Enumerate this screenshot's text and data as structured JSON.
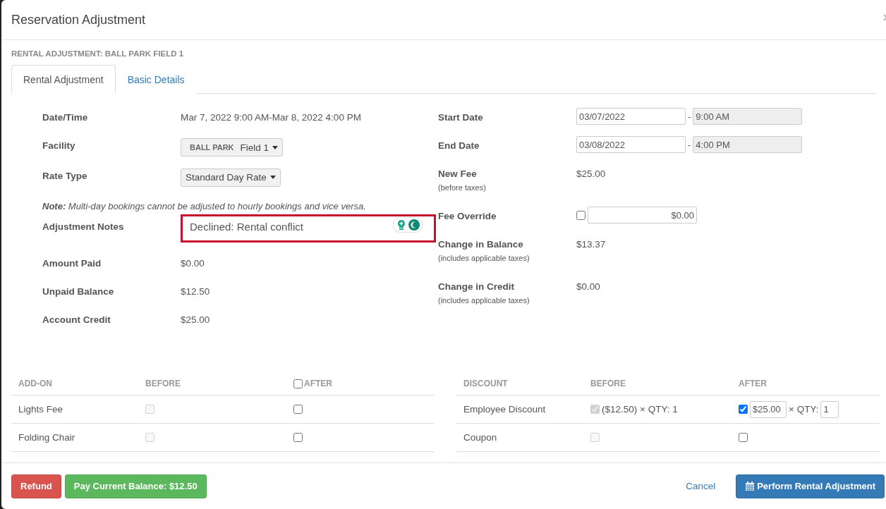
{
  "window": {
    "title": "Reservation Adjustment"
  },
  "section_title": "RENTAL ADJUSTMENT: BALL PARK FIELD 1",
  "tabs": [
    {
      "label": "Rental Adjustment",
      "selected": true
    },
    {
      "label": "Basic Details",
      "selected": false
    }
  ],
  "left_fields": [
    {
      "kind": "text",
      "label": "Date/Time",
      "value": "Mar 7, 2022 9:00 AM-Mar 8, 2022 4:00 PM"
    },
    {
      "kind": "select",
      "label": "Facility",
      "prefix": "BALL PARK",
      "value": "Field 1"
    },
    {
      "kind": "select",
      "label": "Rate Type",
      "value": "Standard Day Rate"
    },
    {
      "kind": "note",
      "value": "**Note:** Multi-day bookings cannot be adjusted to hourly bookings and vice versa."
    },
    {
      "kind": "textarea",
      "label": "Adjustment Notes",
      "value": "Declined: Rental conflict"
    },
    {
      "kind": "text",
      "label": "Amount Paid",
      "value": "$0.00"
    },
    {
      "kind": "text",
      "label": "Unpaid Balance",
      "value": "$12.50"
    },
    {
      "kind": "text",
      "label": "Account Credit",
      "value": "$25.00"
    }
  ],
  "right_fields": [
    {
      "kind": "daterange",
      "label": "Start Date",
      "date": "03/07/2022",
      "separator": "-",
      "time": "9:00 AM",
      "time_disabled": true
    },
    {
      "kind": "daterange",
      "label": "End Date",
      "date": "03/08/2022",
      "separator": "-",
      "time": "4:00 PM",
      "time_disabled": true
    },
    {
      "kind": "text",
      "label": "New Fee",
      "sublabel": "(before taxes)",
      "value": "$25.00"
    },
    {
      "kind": "override",
      "label": "Fee Override",
      "checked": false,
      "value": "$0.00"
    },
    {
      "kind": "text",
      "label": "Change in Balance",
      "sublabel": "(includes applicable taxes)",
      "value": "$13.37"
    },
    {
      "kind": "text",
      "label": "Change in Credit",
      "sublabel": "(includes applicable taxes)",
      "value": "$0.00"
    }
  ],
  "addons": {
    "columns": [
      "ADD-ON",
      "BEFORE",
      "AFTER"
    ],
    "after_all_checked": false,
    "rows": [
      {
        "name": "Lights Fee",
        "before_checked": false,
        "after_checked": false
      },
      {
        "name": "Folding Chair",
        "before_checked": false,
        "after_checked": false
      }
    ]
  },
  "discounts": {
    "columns": [
      "DISCOUNT",
      "BEFORE",
      "AFTER"
    ],
    "rows": [
      {
        "name": "Employee Discount",
        "before_checked": true,
        "before_text": "($12.50) × QTY: 1",
        "after_checked": true,
        "after_amount": "$25.00",
        "after_qty_label": "× QTY:",
        "after_qty": "1"
      },
      {
        "name": "Coupon",
        "before_checked": false,
        "after_checked": false
      }
    ]
  },
  "footer": {
    "refund": "Refund",
    "pay": "Pay Current Balance: $12.50",
    "cancel": "Cancel",
    "perform": "Perform Rental Adjustment"
  }
}
